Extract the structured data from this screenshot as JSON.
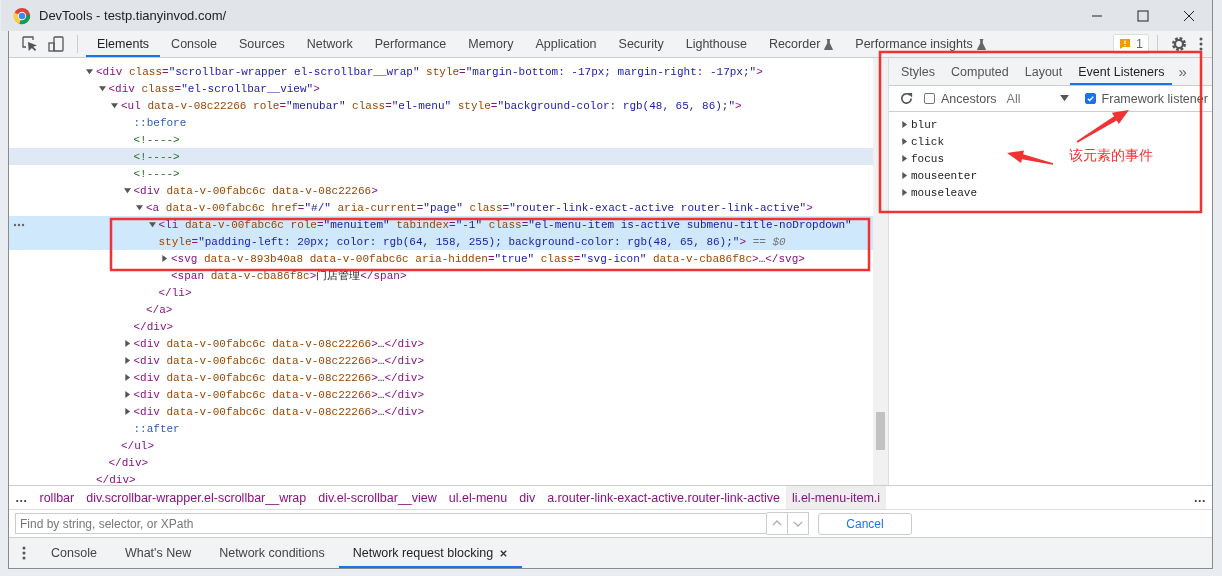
{
  "window": {
    "title": "DevTools - testp.tianyinvod.com/"
  },
  "main_tabs": [
    {
      "label": "Elements",
      "selected": true,
      "experimental": false
    },
    {
      "label": "Console",
      "selected": false,
      "experimental": false
    },
    {
      "label": "Sources",
      "selected": false,
      "experimental": false
    },
    {
      "label": "Network",
      "selected": false,
      "experimental": false
    },
    {
      "label": "Performance",
      "selected": false,
      "experimental": false
    },
    {
      "label": "Memory",
      "selected": false,
      "experimental": false
    },
    {
      "label": "Application",
      "selected": false,
      "experimental": false
    },
    {
      "label": "Security",
      "selected": false,
      "experimental": false
    },
    {
      "label": "Lighthouse",
      "selected": false,
      "experimental": false
    },
    {
      "label": "Recorder",
      "selected": false,
      "experimental": true
    },
    {
      "label": "Performance insights",
      "selected": false,
      "experimental": true
    }
  ],
  "issues": {
    "count": "1"
  },
  "dom_tree": [
    {
      "text": "<div class=\"scrollbar-wrapper el-scrollbar__wrap\" style=\"margin-bottom: -17px; margin-right: -17px;\">",
      "expanded": true,
      "selected": false,
      "hovered": false,
      "close": "</div>",
      "children": [
        {
          "text": "<div class=\"el-scrollbar__view\">",
          "expanded": true,
          "selected": false,
          "hovered": false,
          "close": "</div>",
          "children": [
            {
              "text": "<ul data-v-08c22266 role=\"menubar\" class=\"el-menu\" style=\"background-color: rgb(48, 65, 86);\">",
              "expanded": true,
              "selected": false,
              "hovered": false,
              "close": "</ul>",
              "children": [
                {
                  "text": "::before",
                  "selected": false,
                  "hovered": false
                },
                {
                  "text": "<!---->",
                  "selected": false,
                  "hovered": false
                },
                {
                  "text": "<!---->",
                  "selected": false,
                  "hovered": true
                },
                {
                  "text": "<!---->",
                  "selected": false,
                  "hovered": false
                },
                {
                  "text": "<div data-v-00fabc6c data-v-08c22266>",
                  "expanded": true,
                  "selected": false,
                  "hovered": false,
                  "close": "</div>",
                  "children": [
                    {
                      "text": "<a data-v-00fabc6c href=\"#/\" aria-current=\"page\" class=\"router-link-exact-active router-link-active\">",
                      "expanded": true,
                      "selected": false,
                      "hovered": false,
                      "close": "</a>",
                      "children": [
                        {
                          "text": "<li data-v-00fabc6c role=\"menuitem\" tabindex=\"-1\" class=\"el-menu-item is-active submenu-title-noDropdown\"",
                          "text_wrap": "style=\"padding-left: 20px; color: rgb(64, 158, 255); background-color: rgb(48, 65, 86);\">",
                          "console_ref": "== $0",
                          "expanded": true,
                          "selected": true,
                          "hovered": false,
                          "close": "</li>",
                          "children": [
                            {
                              "text": "<svg data-v-893b40a8 data-v-00fabc6c aria-hidden=\"true\" class=\"svg-icon\" data-v-cba86f8c>…</svg>",
                              "expanded": false,
                              "selected": false,
                              "hovered": false
                            },
                            {
                              "text": "<span data-v-cba86f8c>门店管理</span>",
                              "selected": false,
                              "hovered": false
                            }
                          ]
                        }
                      ]
                    }
                  ]
                },
                {
                  "text": "<div data-v-00fabc6c data-v-08c22266>…</div>",
                  "expanded": false,
                  "selected": false,
                  "hovered": false
                },
                {
                  "text": "<div data-v-00fabc6c data-v-08c22266>…</div>",
                  "expanded": false,
                  "selected": false,
                  "hovered": false
                },
                {
                  "text": "<div data-v-00fabc6c data-v-08c22266>…</div>",
                  "expanded": false,
                  "selected": false,
                  "hovered": false
                },
                {
                  "text": "<div data-v-00fabc6c data-v-08c22266>…</div>",
                  "expanded": false,
                  "selected": false,
                  "hovered": false
                },
                {
                  "text": "<div data-v-00fabc6c data-v-08c22266>…</div>",
                  "expanded": false,
                  "selected": false,
                  "hovered": false
                },
                {
                  "text": "::after",
                  "selected": false,
                  "hovered": false
                }
              ]
            }
          ]
        }
      ]
    }
  ],
  "breadcrumbs": [
    {
      "label": "…",
      "kind": "more",
      "selected": false
    },
    {
      "label": "rollbar",
      "kind": "crumb",
      "selected": false
    },
    {
      "label": "div.scrollbar-wrapper.el-scrollbar__wrap",
      "kind": "crumb",
      "selected": false
    },
    {
      "label": "div.el-scrollbar__view",
      "kind": "crumb",
      "selected": false
    },
    {
      "label": "ul.el-menu",
      "kind": "crumb",
      "selected": false
    },
    {
      "label": "div",
      "kind": "crumb",
      "selected": false
    },
    {
      "label": "a.router-link-exact-active.router-link-active",
      "kind": "crumb",
      "selected": false
    },
    {
      "label": "li.el-menu-item.i",
      "kind": "crumb",
      "selected": true
    },
    {
      "label": "…",
      "kind": "more",
      "selected": false
    }
  ],
  "search": {
    "placeholder": "Find by string, selector, or XPath",
    "cancel": "Cancel"
  },
  "drawer_tabs": [
    {
      "label": "Console",
      "selected": false,
      "closable": false
    },
    {
      "label": "What's New",
      "selected": false,
      "closable": false
    },
    {
      "label": "Network conditions",
      "selected": false,
      "closable": false
    },
    {
      "label": "Network request blocking",
      "selected": true,
      "closable": true
    }
  ],
  "sidebar": {
    "tabs": [
      {
        "label": "Styles",
        "selected": false
      },
      {
        "label": "Computed",
        "selected": false
      },
      {
        "label": "Layout",
        "selected": false
      },
      {
        "label": "Event Listeners",
        "selected": true
      }
    ],
    "more": "»",
    "ancestors": {
      "label": "Ancestors",
      "checked": false
    },
    "filter": {
      "value": "All"
    },
    "framework": {
      "label": "Framework listener",
      "checked": true
    },
    "events": [
      {
        "name": "blur",
        "expanded": false
      },
      {
        "name": "click",
        "expanded": false
      },
      {
        "name": "focus",
        "expanded": false
      },
      {
        "name": "mouseenter",
        "expanded": false
      },
      {
        "name": "mouseleave",
        "expanded": false
      }
    ]
  },
  "annotations": [
    {
      "kind": "box"
    },
    {
      "kind": "box"
    },
    {
      "kind": "arrow"
    },
    {
      "kind": "arrow"
    },
    {
      "kind": "label",
      "text": "该元素的事件"
    }
  ]
}
